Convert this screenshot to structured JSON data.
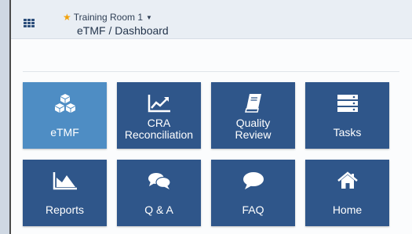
{
  "header": {
    "room_name": "Training Room 1",
    "breadcrumb": "eTMF / Dashboard"
  },
  "tiles": [
    {
      "label": "eTMF",
      "icon": "cubes-icon",
      "active": true
    },
    {
      "label": "CRA Reconciliation",
      "label_line1": "CRA",
      "label_line2": "Reconciliation",
      "icon": "line-chart-icon"
    },
    {
      "label": "Quality Review",
      "label_line1": "Quality",
      "label_line2": "Review",
      "icon": "book-icon"
    },
    {
      "label": "Tasks",
      "icon": "tasks-list-icon"
    },
    {
      "label": "Reports",
      "icon": "area-chart-icon"
    },
    {
      "label": "Q & A",
      "icon": "comments-icon"
    },
    {
      "label": "FAQ",
      "icon": "comment-icon"
    },
    {
      "label": "Home",
      "icon": "home-icon"
    }
  ],
  "colors": {
    "tile": "#2f568a",
    "tile_active": "#4e8dc4",
    "star": "#f2a20c"
  }
}
